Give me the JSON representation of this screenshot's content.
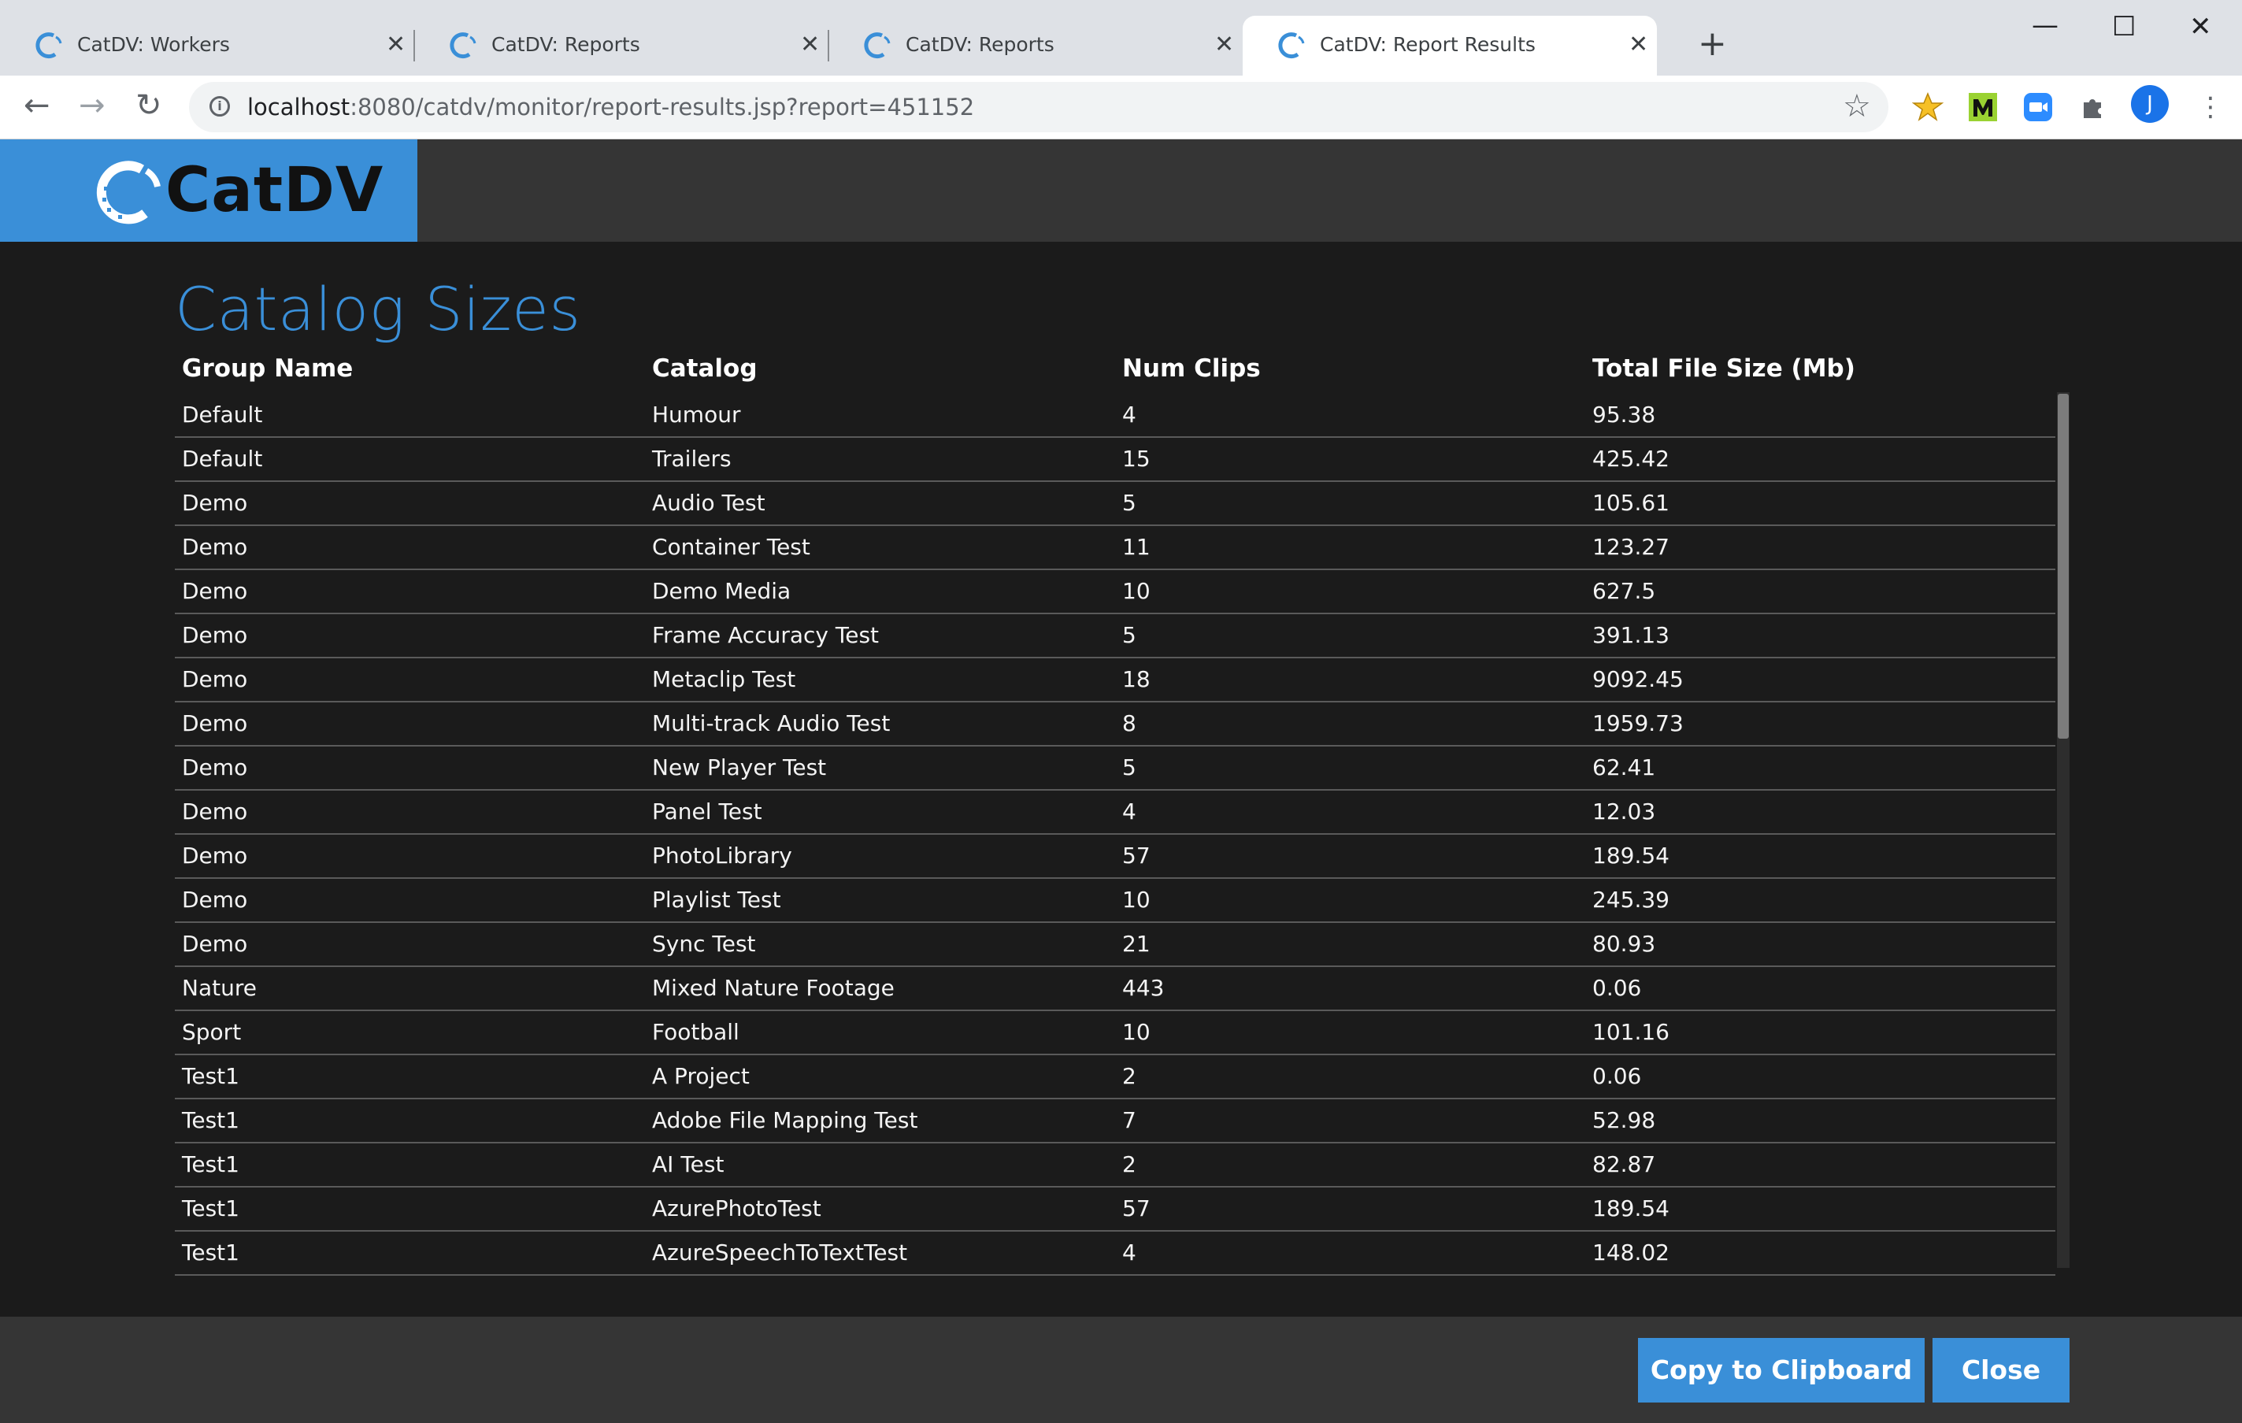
{
  "browser": {
    "tabs": [
      {
        "title": "CatDV: Workers",
        "active": false
      },
      {
        "title": "CatDV: Reports",
        "active": false
      },
      {
        "title": "CatDV: Reports",
        "active": false
      },
      {
        "title": "CatDV: Report Results",
        "active": true
      }
    ],
    "url_host": "localhost",
    "url_rest": ":8080/catdv/monitor/report-results.jsp?report=451152",
    "profile_initial": "J",
    "extensions": [
      "star-extension-icon",
      "m-extension-icon",
      "zoom-extension-icon",
      "puzzle-extensions-icon"
    ]
  },
  "app": {
    "logo_text": "CatDV",
    "brand_color": "#3a8fd8"
  },
  "report": {
    "title": "Catalog Sizes",
    "columns": [
      "Group Name",
      "Catalog",
      "Num Clips",
      "Total File Size (Mb)"
    ],
    "rows": [
      [
        "Default",
        "Humour",
        "4",
        "95.38"
      ],
      [
        "Default",
        "Trailers",
        "15",
        "425.42"
      ],
      [
        "Demo",
        "Audio Test",
        "5",
        "105.61"
      ],
      [
        "Demo",
        "Container Test",
        "11",
        "123.27"
      ],
      [
        "Demo",
        "Demo Media",
        "10",
        "627.5"
      ],
      [
        "Demo",
        "Frame Accuracy Test",
        "5",
        "391.13"
      ],
      [
        "Demo",
        "Metaclip Test",
        "18",
        "9092.45"
      ],
      [
        "Demo",
        "Multi-track Audio Test",
        "8",
        "1959.73"
      ],
      [
        "Demo",
        "New Player Test",
        "5",
        "62.41"
      ],
      [
        "Demo",
        "Panel Test",
        "4",
        "12.03"
      ],
      [
        "Demo",
        "PhotoLibrary",
        "57",
        "189.54"
      ],
      [
        "Demo",
        "Playlist Test",
        "10",
        "245.39"
      ],
      [
        "Demo",
        "Sync Test",
        "21",
        "80.93"
      ],
      [
        "Nature",
        "Mixed Nature Footage",
        "443",
        "0.06"
      ],
      [
        "Sport",
        "Football",
        "10",
        "101.16"
      ],
      [
        "Test1",
        "A Project",
        "2",
        "0.06"
      ],
      [
        "Test1",
        "Adobe File Mapping Test",
        "7",
        "52.98"
      ],
      [
        "Test1",
        "AI Test",
        "2",
        "82.87"
      ],
      [
        "Test1",
        "AzurePhotoTest",
        "57",
        "189.54"
      ],
      [
        "Test1",
        "AzureSpeechToTextTest",
        "4",
        "148.02"
      ]
    ]
  },
  "footer": {
    "copy_label": "Copy to Clipboard",
    "close_label": "Close"
  }
}
